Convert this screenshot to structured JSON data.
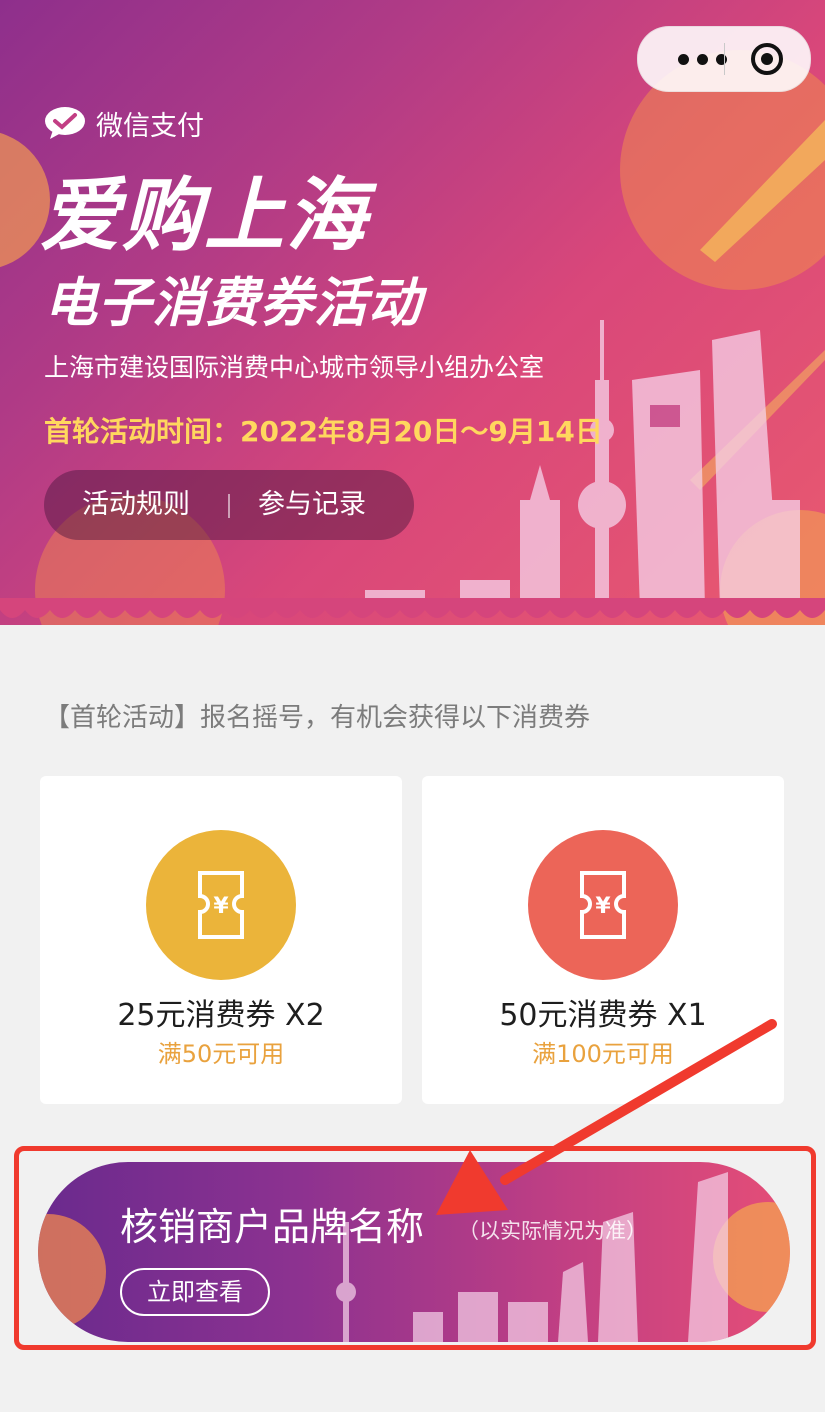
{
  "header": {
    "brand_name": "微信支付",
    "title_line1": "爱购上海",
    "title_line2": "电子消费券活动",
    "organizer": "上海市建设国际消费中心城市领导小组办公室",
    "activity_time": "首轮活动时间：2022年8月20日～9月14日",
    "buttons": {
      "rules": "活动规则",
      "records": "参与记录"
    },
    "capsule_icons": [
      "more-dots-icon",
      "target-icon"
    ]
  },
  "main": {
    "subtitle": "【首轮活动】报名摇号，有机会获得以下消费券",
    "vouchers": [
      {
        "name": "25元消费券 X2",
        "condition": "满50元可用",
        "icon": "voucher-icon",
        "color": "#ebb43a"
      },
      {
        "name": "50元消费券 X1",
        "condition": "满100元可用",
        "icon": "voucher-icon",
        "color": "#ec6558"
      }
    ],
    "merchant_banner": {
      "title": "核销商户品牌名称",
      "note": "（以实际情况为准）",
      "button": "立即查看"
    }
  },
  "colors": {
    "accent_yellow": "#ffd75e",
    "condition_text": "#e9a23e",
    "highlight_red": "#f03a2e"
  }
}
